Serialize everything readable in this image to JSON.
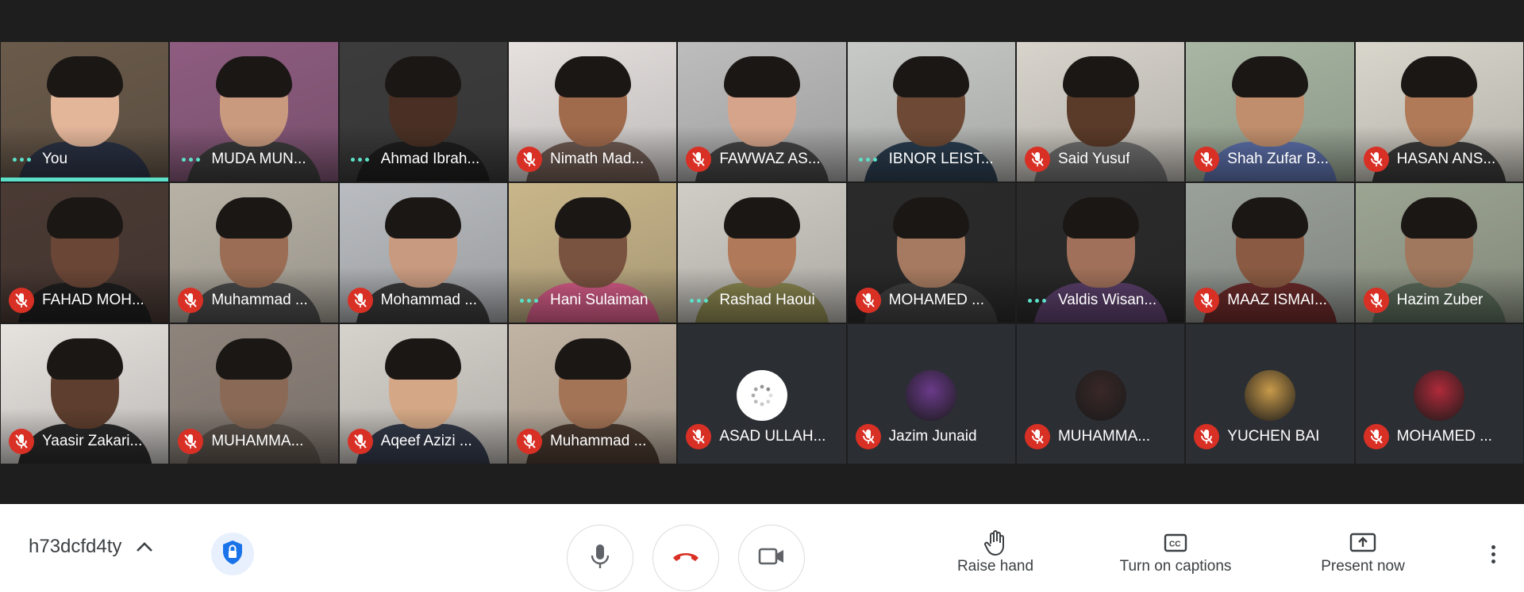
{
  "participants": [
    {
      "name": "You",
      "muted": false,
      "speaking": true,
      "active": true,
      "skin": "#e3b69a",
      "bg": "#6a5a4a",
      "shirt": "#2c3244"
    },
    {
      "name": "MUDA MUN...",
      "muted": false,
      "speaking": true,
      "skin": "#c99a7e",
      "bg": "#8e5c80",
      "shirt": "#3b3b3b"
    },
    {
      "name": "Ahmad Ibrah...",
      "muted": false,
      "speaking": true,
      "skin": "#4a3024",
      "bg": "#3c3c3c",
      "shirt": "#1e1e1e"
    },
    {
      "name": "Nimath Mad...",
      "muted": true,
      "skin": "#a06a4c",
      "bg": "#e6e1df",
      "shirt": "#6e5a52"
    },
    {
      "name": "FAWWAZ AS...",
      "muted": true,
      "skin": "#d6a48a",
      "bg": "#bdbdbd",
      "shirt": "#444444"
    },
    {
      "name": "IBNOR LEIST...",
      "muted": false,
      "speaking": true,
      "skin": "#6e4a36",
      "bg": "#c8cac7",
      "shirt": "#2b3d4f"
    },
    {
      "name": "Said Yusuf",
      "muted": true,
      "skin": "#5a3a28",
      "bg": "#d8d4cc",
      "shirt": "#6e6e6e"
    },
    {
      "name": "Shah Zufar B...",
      "muted": true,
      "skin": "#c08e6c",
      "bg": "#a8b6a3",
      "shirt": "#5c6fa8"
    },
    {
      "name": "HASAN ANS...",
      "muted": true,
      "skin": "#b07a58",
      "bg": "#d9d6cc",
      "shirt": "#3a3a3a"
    },
    {
      "name": "FAHAD MOH...",
      "muted": true,
      "skin": "#6a4636",
      "bg": "#4b3a34",
      "shirt": "#1e1e1e"
    },
    {
      "name": "Muhammad ...",
      "muted": true,
      "skin": "#9a6d54",
      "bg": "#b8b2a6",
      "shirt": "#4a4a4a"
    },
    {
      "name": "Mohammad ...",
      "muted": true,
      "skin": "#c89a80",
      "bg": "#b9bcc0",
      "shirt": "#3a3a3a"
    },
    {
      "name": "Hani Sulaiman",
      "muted": false,
      "speaking": true,
      "skin": "#7a5240",
      "bg": "#c9b68a",
      "shirt": "#d45c86"
    },
    {
      "name": "Rashad Haoui",
      "muted": false,
      "speaking": true,
      "skin": "#b07a5a",
      "bg": "#d0cdc6",
      "shirt": "#8a8650"
    },
    {
      "name": "MOHAMED ...",
      "muted": true,
      "skin": "#a67a60",
      "bg": "#2a2a2a",
      "shirt": "#3f3f3f"
    },
    {
      "name": "Valdis Wisan...",
      "muted": false,
      "speaking": true,
      "skin": "#a0705a",
      "bg": "#2a2a2a",
      "shirt": "#5a3f6a"
    },
    {
      "name": "MAAZ ISMAI...",
      "muted": true,
      "skin": "#8a5a42",
      "bg": "#9aa09a",
      "shirt": "#6a2a2a"
    },
    {
      "name": "Hazim Zuber",
      "muted": true,
      "skin": "#a0785e",
      "bg": "#9ca492",
      "shirt": "#5a6a5a"
    },
    {
      "name": "Yaasir Zakari...",
      "muted": true,
      "skin": "#5e3e2e",
      "bg": "#e6e2de",
      "shirt": "#2a2a2a"
    },
    {
      "name": "MUHAMMA...",
      "muted": true,
      "skin": "#8a6a56",
      "bg": "#8f847c",
      "shirt": "#5c534c"
    },
    {
      "name": "Aqeef Azizi ...",
      "muted": true,
      "skin": "#d4a886",
      "bg": "#d6d2cc",
      "shirt": "#343a4a"
    },
    {
      "name": "Muhammad ...",
      "muted": true,
      "skin": "#a47456",
      "bg": "#c2b4a4",
      "shirt": "#4a3a30"
    },
    {
      "name": "ASAD ULLAH...",
      "muted": true,
      "avatar": "spinner"
    },
    {
      "name": "Jazim Junaid",
      "muted": true,
      "avatar": "#6a3a8a"
    },
    {
      "name": "MUHAMMA...",
      "muted": true,
      "avatar": "#3a2828"
    },
    {
      "name": "YUCHEN BAI",
      "muted": true,
      "avatar": "#c89a4a"
    },
    {
      "name": "MOHAMED ...",
      "muted": true,
      "avatar": "#b02a3a"
    }
  ],
  "toolbar": {
    "meeting_code": "h73dcfd4ty",
    "raise_hand": "Raise hand",
    "captions": "Turn on captions",
    "present": "Present now"
  },
  "colors": {
    "mic_off": "#d93025",
    "active_speaker": "#5ce0c8",
    "hangup": "#d93025"
  }
}
